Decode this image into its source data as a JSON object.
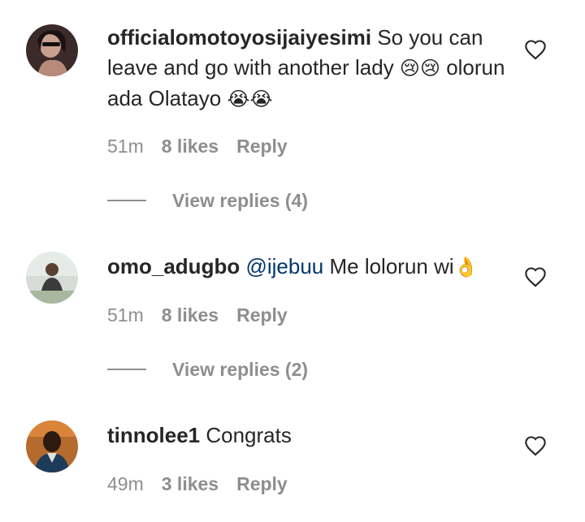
{
  "comments": [
    {
      "username": "officialomotoyosijaiyesimi",
      "text": " So you can leave and go with another lady ",
      "emoji_a": "😢😢",
      "text2": " olorun ada Olatayo ",
      "emoji_b": "😭😭",
      "time": "51m",
      "likes": "8 likes",
      "reply": "Reply",
      "view_replies": "View replies (4)",
      "avatar": "avatar-photo"
    },
    {
      "username": "omo_adugbo",
      "mention": "@ijebuu",
      "text": " Me lolorun wi",
      "emoji": "👌",
      "time": "51m",
      "likes": "8 likes",
      "reply": "Reply",
      "view_replies": "View replies (2)",
      "avatar": "avatar-photo"
    },
    {
      "username": "tinnolee1",
      "text": " Congrats",
      "time": "49m",
      "likes": "3 likes",
      "reply": "Reply",
      "avatar": "avatar-photo"
    }
  ],
  "icons": {
    "like": "heart-outline-icon"
  },
  "colors": {
    "text": "#262626",
    "muted": "#8e8e8e",
    "mention": "#00376b"
  }
}
